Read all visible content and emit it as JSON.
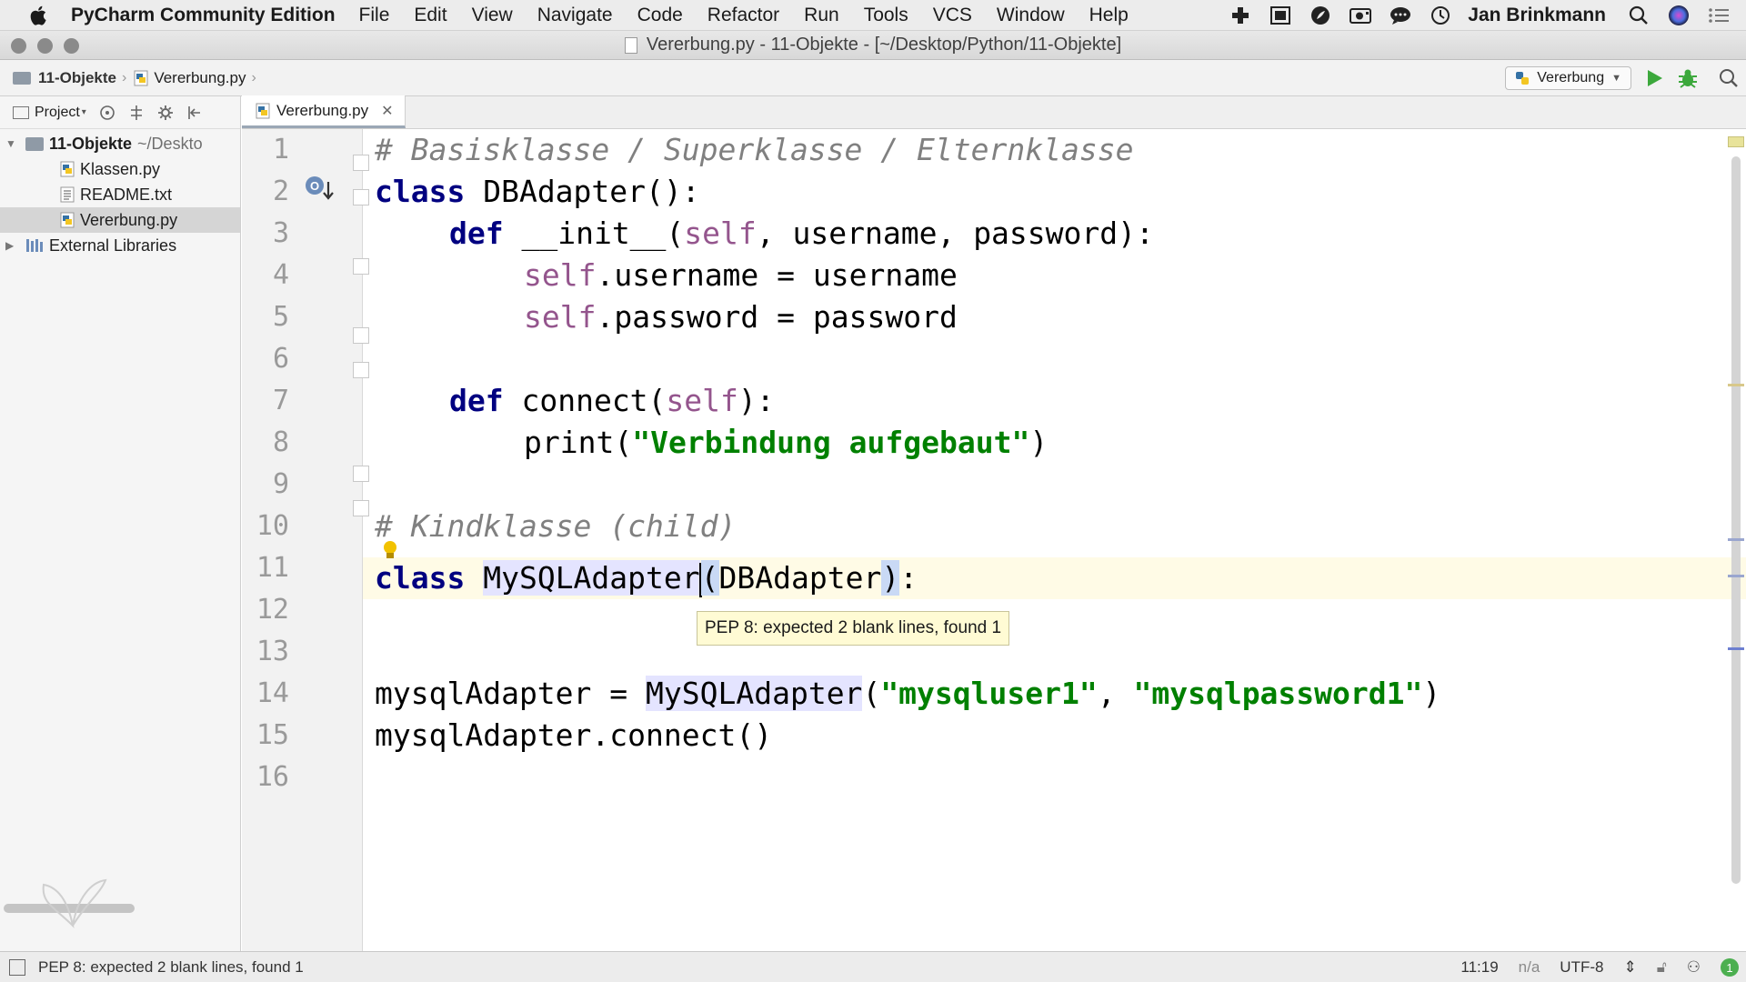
{
  "menubar": {
    "app_name": "PyCharm Community Edition",
    "items": [
      "File",
      "Edit",
      "View",
      "Navigate",
      "Code",
      "Refactor",
      "Run",
      "Tools",
      "VCS",
      "Window",
      "Help"
    ],
    "user": "Jan Brinkmann",
    "status_icons": [
      "plus-icon",
      "clipboard-icon",
      "leaf-icon",
      "video-icon",
      "chat-icon",
      "history-icon"
    ]
  },
  "window": {
    "title": "Vererbung.py - 11-Objekte - [~/Desktop/Python/11-Objekte]"
  },
  "navbar": {
    "project": "11-Objekte",
    "file": "Vererbung.py",
    "run_config": "Vererbung"
  },
  "project_panel": {
    "label": "Project",
    "root": {
      "name": "11-Objekte",
      "path": "~/Deskto"
    },
    "files": [
      "Klassen.py",
      "README.txt",
      "Vererbung.py"
    ],
    "external": "External Libraries"
  },
  "tabs": [
    {
      "label": "Vererbung.py",
      "active": true
    }
  ],
  "editor": {
    "line_numbers": [
      "1",
      "2",
      "3",
      "4",
      "5",
      "6",
      "7",
      "8",
      "9",
      "10",
      "11",
      "12",
      "13",
      "14",
      "15",
      "16"
    ],
    "code": {
      "l1_comment": "# Basisklasse / Superklasse / Elternklasse",
      "l2_kw": "class",
      "l2_rest": " DBAdapter():",
      "l3_kw": "def",
      "l3_name": " __init__(",
      "l3_self": "self",
      "l3_rest": ", username, password):",
      "l4_self": "self",
      "l4_rest": ".username = username",
      "l5_self": "self",
      "l5_rest": ".password = password",
      "l7_kw": "def",
      "l7_name": " connect(",
      "l7_self": "self",
      "l7_rest": "):",
      "l8_name": "print(",
      "l8_str": "\"Verbindung aufgebaut\"",
      "l8_rest": ")",
      "l10_comment": "# Kindklasse (child)",
      "l11_kw": "class",
      "l11_name": "MySQLAdapter",
      "l11_paren_open": "(",
      "l11_base": "DBAdapter",
      "l11_paren_close": ")",
      "l11_rest": ":",
      "l14_var": "mysqlAdapter = ",
      "l14_cls": "MySQLAdapter",
      "l14_open": "(",
      "l14_str1": "\"mysqluser1\"",
      "l14_comma": ", ",
      "l14_str2": "\"mysqlpassword1\"",
      "l14_close": ")",
      "l15": "mysqlAdapter.connect()"
    },
    "tooltip": "PEP 8: expected 2 blank lines, found 1"
  },
  "statusbar": {
    "message": "PEP 8: expected 2 blank lines, found 1",
    "position": "11:19",
    "line_sep": "n/a",
    "encoding": "UTF-8",
    "badge": "1"
  },
  "colors": {
    "keyword": "#000080",
    "string": "#008000",
    "comment": "#808080",
    "self": "#94558d",
    "current_line": "#fffbe6"
  }
}
